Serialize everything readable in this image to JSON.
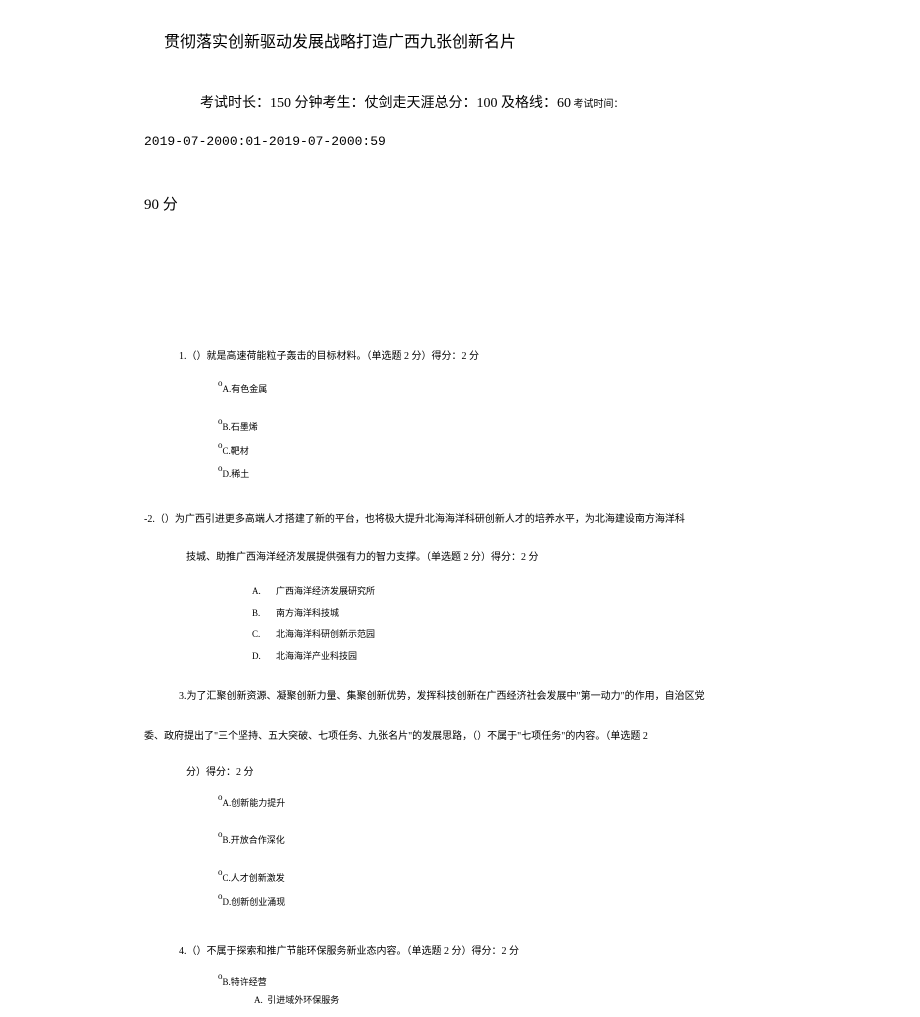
{
  "title": "贯彻落实创新驱动发展战略打造广西九张创新名片",
  "meta": {
    "duration_label": "考试时长：",
    "duration_value": "150 分钟",
    "candidate_label": "考生：",
    "candidate_value": "仗剑走天涯",
    "total_label": "总分：",
    "total_value": "100",
    "pass_label": " 及格线：",
    "pass_value": "60",
    "exam_time_label": " 考试时间："
  },
  "time_range": "2019-07-2000:01-2019-07-2000:59",
  "score": "90 分",
  "q1": {
    "stem": "1.（）就是高速荷能粒子轰击的目标材料。（单选题 2 分）得分：2 分",
    "a": "A.有色金属",
    "b": "B.石墨烯",
    "c": "C.靶材",
    "d": "D.稀土"
  },
  "q2": {
    "stem1": "-2.（）为广西引进更多高端人才搭建了新的平台，也将极大提升北海海洋科研创新人才的培养水平，为北海建设南方海洋科",
    "stem2": "技城、助推广西海洋经济发展提供强有力的智力支撑。（单选题 2 分）得分：2 分",
    "a_label": "A.",
    "a": "广西海洋经济发展研究所",
    "b_label": "B.",
    "b": "南方海洋科技城",
    "c_label": "C.",
    "c": "北海海洋科研创新示范园",
    "d_label": "D.",
    "d": "北海海洋产业科技园"
  },
  "q3": {
    "stem1": "3.为了汇聚创新资源、凝聚创新力量、集聚创新优势，发挥科技创新在广西经济社会发展中\"第一动力\"的作用，自治区党",
    "stem2": "委、政府提出了\"三个坚持、五大突破、七项任务、九张名片\"的发展思路，（）不属于\"七项任务\"的内容。（单选题 2",
    "stem3": "分）得分：2 分",
    "a": "A.创新能力提升",
    "b": "B.开放合作深化",
    "c": "C.人才创新激发",
    "d": "D.创新创业涌现"
  },
  "q4": {
    "stem": "4.（）不属于探索和推广节能环保服务新业态内容。（单选题 2 分）得分：2 分",
    "b": "B.特许经营",
    "a_label": "A.",
    "a": "引进域外环保服务"
  }
}
